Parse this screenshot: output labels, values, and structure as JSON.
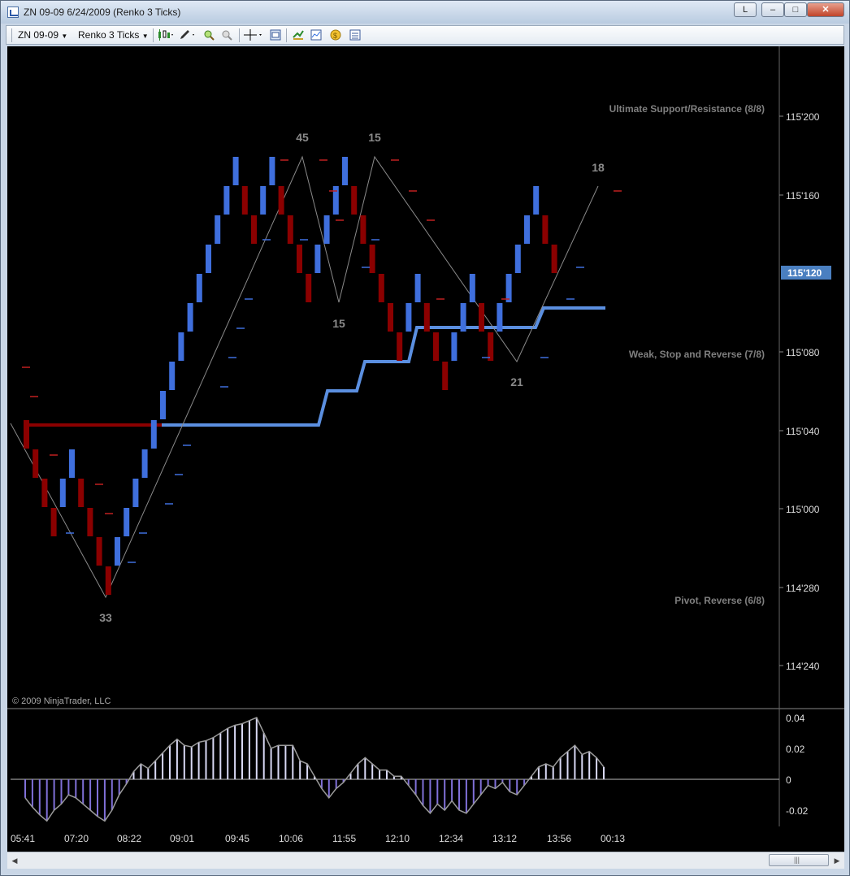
{
  "window": {
    "title": "ZN 09-09  6/24/2009 (Renko 3 Ticks)",
    "btn_l": "L",
    "btn_min": "–",
    "btn_max": "□",
    "btn_close": "✕"
  },
  "toolbar": {
    "instrument": "ZN 09-09",
    "period": "Renko 3 Ticks",
    "icons": [
      "candlestick-chart-icon",
      "pencil-draw-icon",
      "zoom-in-icon",
      "zoom-out-icon",
      "crosshair-icon",
      "properties-icon",
      "strategy-icon",
      "chart-data-icon",
      "currency-icon",
      "data-box-icon"
    ]
  },
  "chart": {
    "copyright": "© 2009 NinjaTrader, LLC",
    "price_labels": [
      "115'200",
      "115'160",
      "115'080",
      "115'040",
      "115'000",
      "114'280",
      "114'240"
    ],
    "current_price": "115'120",
    "level_labels": [
      "Ultimate Support/Resistance (8/8)",
      "Weak, Stop and Reverse (7/8)",
      "Pivot, Reverse (6/8)"
    ],
    "swing_labels": [
      "45",
      "15",
      "15",
      "18",
      "21",
      "33"
    ],
    "osc_labels": [
      "0.04",
      "0.02",
      "0",
      "-0.02"
    ],
    "time_labels": [
      "05:41",
      "07:20",
      "08:22",
      "09:01",
      "09:45",
      "10:06",
      "11:55",
      "12:10",
      "12:34",
      "13:12",
      "13:56",
      "00:13"
    ],
    "colors": {
      "up": "#3f6fdd",
      "down": "#8b0000",
      "stop_line": "#5b8fe0",
      "osc_fill": "#8070d8",
      "osc_fill_pos": "#d9d9f5",
      "label": "#8a8a8a"
    },
    "scrollbar_grip": "|||"
  }
}
